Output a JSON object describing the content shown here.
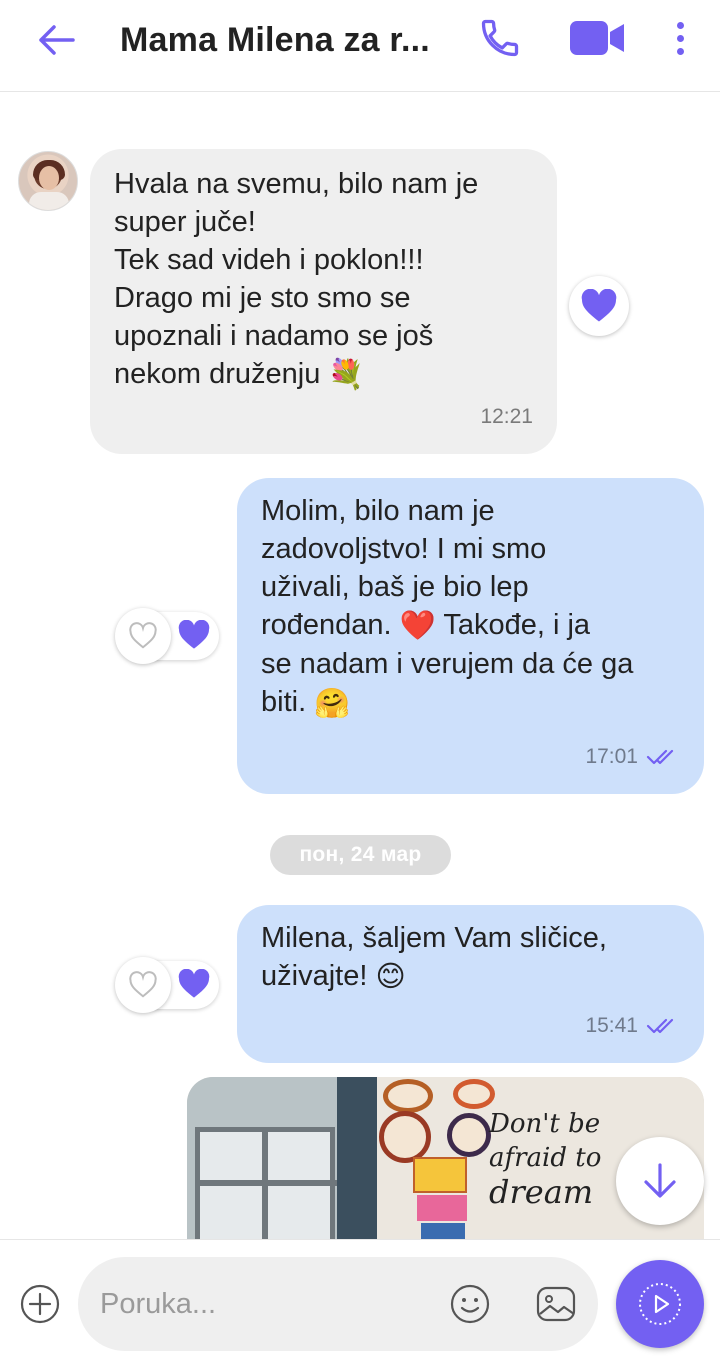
{
  "header": {
    "title": "Mama Milena za r...",
    "back_icon": "arrow-left-icon",
    "call_icon": "phone-icon",
    "video_icon": "video-camera-icon",
    "more_icon": "more-vertical-icon"
  },
  "colors": {
    "accent": "#7360f2",
    "incoming_bubble": "#efefef",
    "outgoing_bubble": "#cde0fb",
    "heart_filled": "#7360f2"
  },
  "messages": [
    {
      "direction": "incoming",
      "text": "Hvala na svemu, bilo nam je\nsuper juče!\nTek sad videh i poklon!!!\nDrago mi je sto smo se\nupoznali i nadamo se još\nnekom druženju",
      "emoji": "💐",
      "time": "12:21",
      "reaction": "heart-filled-icon"
    },
    {
      "direction": "outgoing",
      "text_parts": [
        "Molim, bilo nam je\nzadovoljstvo! I mi smo\nuživali, baš je bio lep\nrođendan. ",
        "❤️",
        " Takođe, i ja\nse nadam i verujem da će ga\nbiti. ",
        "🤗"
      ],
      "time": "17:01",
      "status": "double-check-icon",
      "reactions": [
        "heart-outline-icon",
        "heart-filled-icon"
      ]
    },
    {
      "direction": "outgoing",
      "text": "Milena, šaljem Vam sličice,\nuživajte! ",
      "emoji": "😊",
      "time": "15:41",
      "status": "double-check-icon",
      "reactions": [
        "heart-outline-icon",
        "heart-filled-icon"
      ]
    }
  ],
  "date_separator": "пон, 24 мар",
  "photo": {
    "quote_line1": "Don't be\nafraid to",
    "quote_line2": "dream"
  },
  "scroll_button_icon": "arrow-down-icon",
  "composer": {
    "add_icon": "plus-circle-icon",
    "placeholder": "Poruka...",
    "emoji_icon": "smiley-icon",
    "gallery_icon": "gallery-icon",
    "send_icon": "play-circle-icon"
  }
}
